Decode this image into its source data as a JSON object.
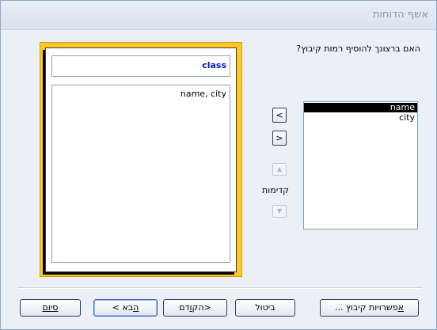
{
  "window": {
    "title": "אשף הדוחות"
  },
  "question": "האם ברצונך להוסיף רמות קיבוץ?",
  "preview": {
    "header_label": "class",
    "body_label": "name, city"
  },
  "fields": {
    "items": [
      {
        "label": "name",
        "selected": true
      },
      {
        "label": "city",
        "selected": false
      }
    ]
  },
  "controls": {
    "add_label": "<",
    "remove_label": ">",
    "priority_label": "קדימות",
    "priority_up_icon": "arrow-up-icon",
    "priority_down_icon": "arrow-down-icon"
  },
  "buttons": {
    "finish": "סיום",
    "next_prefix": "",
    "next_underlined": "ה",
    "next_suffix": "בא >",
    "back_prefix": "<הק",
    "back_underlined": "ו",
    "back_suffix": "דם",
    "cancel": "ביטול",
    "group_options_underlined": "א",
    "group_options_rest": "פשרויות קיבוץ ..."
  }
}
